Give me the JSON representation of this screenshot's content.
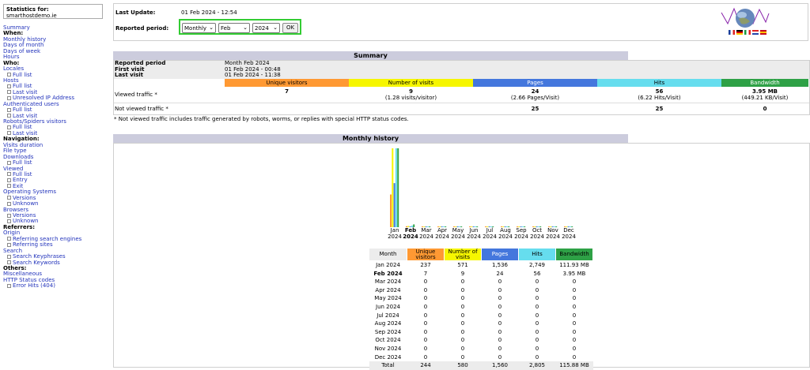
{
  "sidebar": {
    "stats_label": "Statistics for:",
    "site": "smarthostdemo.ie",
    "items": [
      {
        "type": "link",
        "label": "Summary"
      },
      {
        "type": "head",
        "label": "When:"
      },
      {
        "type": "link",
        "label": "Monthly history"
      },
      {
        "type": "link",
        "label": "Days of month"
      },
      {
        "type": "link",
        "label": "Days of week"
      },
      {
        "type": "link",
        "label": "Hours"
      },
      {
        "type": "head",
        "label": "Who:"
      },
      {
        "type": "link",
        "label": "Locales"
      },
      {
        "type": "sub",
        "label": "Full list"
      },
      {
        "type": "link",
        "label": "Hosts"
      },
      {
        "type": "sub",
        "label": "Full list"
      },
      {
        "type": "sub",
        "label": "Last visit"
      },
      {
        "type": "sub",
        "label": "Unresolved IP Address"
      },
      {
        "type": "link",
        "label": "Authenticated users"
      },
      {
        "type": "sub",
        "label": "Full list"
      },
      {
        "type": "sub",
        "label": "Last visit"
      },
      {
        "type": "link",
        "label": "Robots/Spiders visitors"
      },
      {
        "type": "sub",
        "label": "Full list"
      },
      {
        "type": "sub",
        "label": "Last visit"
      },
      {
        "type": "head",
        "label": "Navigation:"
      },
      {
        "type": "link",
        "label": "Visits duration"
      },
      {
        "type": "link",
        "label": "File type"
      },
      {
        "type": "link",
        "label": "Downloads"
      },
      {
        "type": "sub",
        "label": "Full list"
      },
      {
        "type": "link",
        "label": "Viewed"
      },
      {
        "type": "sub",
        "label": "Full list"
      },
      {
        "type": "sub",
        "label": "Entry"
      },
      {
        "type": "sub",
        "label": "Exit"
      },
      {
        "type": "link",
        "label": "Operating Systems"
      },
      {
        "type": "sub",
        "label": "Versions"
      },
      {
        "type": "sub",
        "label": "Unknown"
      },
      {
        "type": "link",
        "label": "Browsers"
      },
      {
        "type": "sub",
        "label": "Versions"
      },
      {
        "type": "sub",
        "label": "Unknown"
      },
      {
        "type": "head",
        "label": "Referrers:"
      },
      {
        "type": "link",
        "label": "Origin"
      },
      {
        "type": "sub",
        "label": "Referring search engines"
      },
      {
        "type": "sub",
        "label": "Referring sites"
      },
      {
        "type": "link",
        "label": "Search"
      },
      {
        "type": "sub",
        "label": "Search Keyphrases"
      },
      {
        "type": "sub",
        "label": "Search Keywords"
      },
      {
        "type": "head",
        "label": "Others:"
      },
      {
        "type": "link",
        "label": "Miscellaneous"
      },
      {
        "type": "link",
        "label": "HTTP Status codes"
      },
      {
        "type": "sub",
        "label": "Error Hits (404)"
      }
    ]
  },
  "header": {
    "last_update_label": "Last Update:",
    "last_update_value": "01 Feb 2024 - 12:54",
    "reported_period_label": "Reported period:",
    "period_type": "Monthly",
    "month": "Feb",
    "year": "2024",
    "ok_label": "OK",
    "flags": [
      "fr",
      "de",
      "it",
      "nl",
      "es"
    ]
  },
  "summary": {
    "title": "Summary",
    "info": [
      {
        "k": "Reported period",
        "v": "Month Feb 2024"
      },
      {
        "k": "First visit",
        "v": "01 Feb 2024 - 00:48"
      },
      {
        "k": "Last visit",
        "v": "01 Feb 2024 - 11:38"
      }
    ],
    "columns": [
      {
        "label": "Unique visitors",
        "color": "#ff9933"
      },
      {
        "label": "Number of visits",
        "color": "#f6f600"
      },
      {
        "label": "Pages",
        "color": "#4477dd"
      },
      {
        "label": "Hits",
        "color": "#66ddee"
      },
      {
        "label": "Bandwidth",
        "color": "#2ea146"
      }
    ],
    "viewed_label": "Viewed traffic *",
    "viewed": [
      {
        "main": "7",
        "sub": ""
      },
      {
        "main": "9",
        "sub": "(1.28 visits/visitor)"
      },
      {
        "main": "24",
        "sub": "(2.66 Pages/Visit)"
      },
      {
        "main": "56",
        "sub": "(6.22 Hits/Visit)"
      },
      {
        "main": "3.95 MB",
        "sub": "(449.21 KB/Visit)"
      }
    ],
    "not_viewed_label": "Not viewed traffic *",
    "not_viewed": [
      "",
      "",
      "25",
      "25",
      "0"
    ],
    "note": "* Not viewed traffic includes traffic generated by robots, worms, or replies with special HTTP status codes."
  },
  "history": {
    "title": "Monthly history",
    "headers": [
      "Month",
      "Unique visitors",
      "Number of visits",
      "Pages",
      "Hits",
      "Bandwidth"
    ],
    "rows": [
      {
        "m": "Jan 2024",
        "u": "237",
        "v": "571",
        "p": "1,536",
        "h": "2,749",
        "b": "111.93 MB"
      },
      {
        "m": "Feb 2024",
        "u": "7",
        "v": "9",
        "p": "24",
        "h": "56",
        "b": "3.95 MB"
      },
      {
        "m": "Mar 2024",
        "u": "0",
        "v": "0",
        "p": "0",
        "h": "0",
        "b": "0"
      },
      {
        "m": "Apr 2024",
        "u": "0",
        "v": "0",
        "p": "0",
        "h": "0",
        "b": "0"
      },
      {
        "m": "May 2024",
        "u": "0",
        "v": "0",
        "p": "0",
        "h": "0",
        "b": "0"
      },
      {
        "m": "Jun 2024",
        "u": "0",
        "v": "0",
        "p": "0",
        "h": "0",
        "b": "0"
      },
      {
        "m": "Jul 2024",
        "u": "0",
        "v": "0",
        "p": "0",
        "h": "0",
        "b": "0"
      },
      {
        "m": "Aug 2024",
        "u": "0",
        "v": "0",
        "p": "0",
        "h": "0",
        "b": "0"
      },
      {
        "m": "Sep 2024",
        "u": "0",
        "v": "0",
        "p": "0",
        "h": "0",
        "b": "0"
      },
      {
        "m": "Oct 2024",
        "u": "0",
        "v": "0",
        "p": "0",
        "h": "0",
        "b": "0"
      },
      {
        "m": "Nov 2024",
        "u": "0",
        "v": "0",
        "p": "0",
        "h": "0",
        "b": "0"
      },
      {
        "m": "Dec 2024",
        "u": "0",
        "v": "0",
        "p": "0",
        "h": "0",
        "b": "0"
      }
    ],
    "total": {
      "m": "Total",
      "u": "244",
      "v": "580",
      "p": "1,560",
      "h": "2,805",
      "b": "115.88 MB"
    }
  },
  "chart_data": {
    "type": "bar",
    "categories": [
      "Jan 2024",
      "Feb 2024",
      "Mar 2024",
      "Apr 2024",
      "May 2024",
      "Jun 2024",
      "Jul 2024",
      "Aug 2024",
      "Sep 2024",
      "Oct 2024",
      "Nov 2024",
      "Dec 2024"
    ],
    "series": [
      {
        "name": "Unique visitors",
        "color": "#ff9933",
        "values": [
          237,
          7,
          0,
          0,
          0,
          0,
          0,
          0,
          0,
          0,
          0,
          0
        ]
      },
      {
        "name": "Number of visits",
        "color": "#f6f600",
        "values": [
          571,
          9,
          0,
          0,
          0,
          0,
          0,
          0,
          0,
          0,
          0,
          0
        ]
      },
      {
        "name": "Pages",
        "color": "#4477dd",
        "values": [
          1536,
          24,
          0,
          0,
          0,
          0,
          0,
          0,
          0,
          0,
          0,
          0
        ]
      },
      {
        "name": "Hits",
        "color": "#66ddee",
        "values": [
          2749,
          56,
          0,
          0,
          0,
          0,
          0,
          0,
          0,
          0,
          0,
          0
        ]
      },
      {
        "name": "Bandwidth",
        "color": "#2ea146",
        "values": [
          111.93,
          3.95,
          0,
          0,
          0,
          0,
          0,
          0,
          0,
          0,
          0,
          0
        ]
      }
    ],
    "bold_category": "Feb 2024"
  }
}
